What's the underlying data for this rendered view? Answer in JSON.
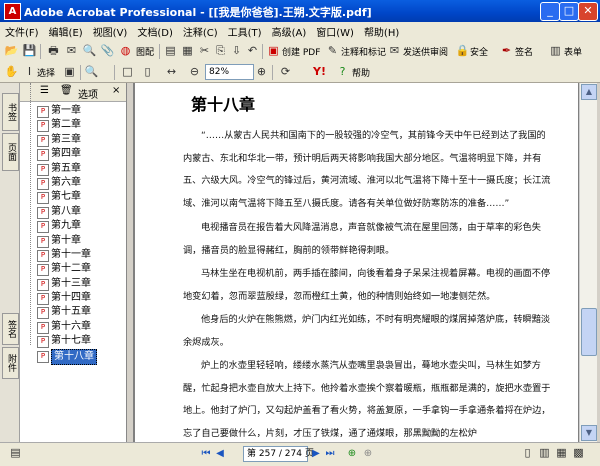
{
  "window": {
    "title": "Adobe Acrobat Professional - [[我是你爸爸].王朔.文字版.pdf]"
  },
  "menu": [
    "文件(F)",
    "编辑(E)",
    "视图(V)",
    "文档(D)",
    "注释(C)",
    "工具(T)",
    "高级(A)",
    "窗口(W)",
    "帮助(H)"
  ],
  "toolbar1": {
    "create_pdf": "创建 PDF",
    "comment_markup": "注释和标记",
    "send_for_review": "发送供审阅",
    "secure": "安全",
    "sign": "签名",
    "forms": "表单",
    "organize": "图配"
  },
  "toolbar2": {
    "select": "选择",
    "zoom": "82%",
    "help": "帮助"
  },
  "sidebar_tabs": [
    "书签",
    "页面",
    "签名",
    "附件"
  ],
  "bookmarks": {
    "options_label": "选项",
    "items": [
      "第一章",
      "第二章",
      "第三章",
      "第四章",
      "第五章",
      "第六章",
      "第七章",
      "第八章",
      "第九章",
      "第十章",
      "第十一章",
      "第十二章",
      "第十三章",
      "第十四章",
      "第十五章",
      "第十六章",
      "第十七章",
      "第十八章"
    ],
    "selected_index": 17
  },
  "document": {
    "chapter_title": "第十八章",
    "paragraphs": [
      "“……从蒙古人民共和国南下的一股较强的冷空气，其前锋今天中午已经到达了我国的内蒙古、东北和华北一带，预计明后两天将影响我国大部分地区。气温将明显下降，并有五、六级大风。冷空气的锋过后，黄河流域、淮河以北气温将下降十至十一摄氏度；长江流域、淮河以南气温将下降五至八摄氏度。请各有关单位做好防寒防冻的准备……”",
      "电视播音员在报告着大风降温消息，声音就像被气流在屋里回荡，由于草率的彩色失调，播音员的脸显得赭红，胸前的领带鲜艳得刺眼。",
      "马林生坐在电视机前，两手插在膝间，向後看着身子呆呆注视着屏幕。电视的画面不停地变幻着，忽而翠蓝殷绿，忽而橙红土黄，他的种情则始终如一地凄侧茫然。",
      "他身后的火炉在熊熊燃，炉门内红光如练，不时有明亮耀眼的煤屑掉落炉底，转瞬黯淡余烬成灰。",
      "炉上的水壶里轻轻响，缕缕水蒸汽从壶嘴里袅袅冒出，蓦地水壶尖叫，马林生如梦方醒，忙起身把水壶自放大上持下。他拎着水壶挨个察着暖瓶，瓶瓶都是满的，旋把水壶置于地上。他封了炉门，又勾起炉盖看了看火势，将盖复原，一手拿钩一手拿通条着捋在炉边，忘了自己要做什么，片刻，才压了铁煤，通了通煤眼，那黑黝黝的左松炉"
    ]
  },
  "statusbar": {
    "page_display": "第 257 / 274 页"
  }
}
